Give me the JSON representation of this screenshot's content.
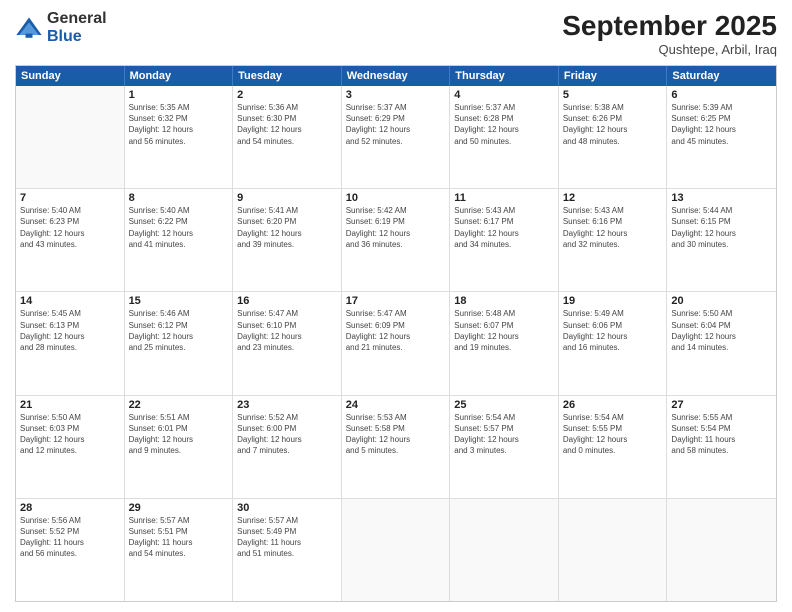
{
  "logo": {
    "general": "General",
    "blue": "Blue"
  },
  "title": "September 2025",
  "location": "Qushtepe, Arbil, Iraq",
  "days": [
    "Sunday",
    "Monday",
    "Tuesday",
    "Wednesday",
    "Thursday",
    "Friday",
    "Saturday"
  ],
  "weeks": [
    [
      {
        "day": "",
        "lines": []
      },
      {
        "day": "1",
        "lines": [
          "Sunrise: 5:35 AM",
          "Sunset: 6:32 PM",
          "Daylight: 12 hours",
          "and 56 minutes."
        ]
      },
      {
        "day": "2",
        "lines": [
          "Sunrise: 5:36 AM",
          "Sunset: 6:30 PM",
          "Daylight: 12 hours",
          "and 54 minutes."
        ]
      },
      {
        "day": "3",
        "lines": [
          "Sunrise: 5:37 AM",
          "Sunset: 6:29 PM",
          "Daylight: 12 hours",
          "and 52 minutes."
        ]
      },
      {
        "day": "4",
        "lines": [
          "Sunrise: 5:37 AM",
          "Sunset: 6:28 PM",
          "Daylight: 12 hours",
          "and 50 minutes."
        ]
      },
      {
        "day": "5",
        "lines": [
          "Sunrise: 5:38 AM",
          "Sunset: 6:26 PM",
          "Daylight: 12 hours",
          "and 48 minutes."
        ]
      },
      {
        "day": "6",
        "lines": [
          "Sunrise: 5:39 AM",
          "Sunset: 6:25 PM",
          "Daylight: 12 hours",
          "and 45 minutes."
        ]
      }
    ],
    [
      {
        "day": "7",
        "lines": [
          "Sunrise: 5:40 AM",
          "Sunset: 6:23 PM",
          "Daylight: 12 hours",
          "and 43 minutes."
        ]
      },
      {
        "day": "8",
        "lines": [
          "Sunrise: 5:40 AM",
          "Sunset: 6:22 PM",
          "Daylight: 12 hours",
          "and 41 minutes."
        ]
      },
      {
        "day": "9",
        "lines": [
          "Sunrise: 5:41 AM",
          "Sunset: 6:20 PM",
          "Daylight: 12 hours",
          "and 39 minutes."
        ]
      },
      {
        "day": "10",
        "lines": [
          "Sunrise: 5:42 AM",
          "Sunset: 6:19 PM",
          "Daylight: 12 hours",
          "and 36 minutes."
        ]
      },
      {
        "day": "11",
        "lines": [
          "Sunrise: 5:43 AM",
          "Sunset: 6:17 PM",
          "Daylight: 12 hours",
          "and 34 minutes."
        ]
      },
      {
        "day": "12",
        "lines": [
          "Sunrise: 5:43 AM",
          "Sunset: 6:16 PM",
          "Daylight: 12 hours",
          "and 32 minutes."
        ]
      },
      {
        "day": "13",
        "lines": [
          "Sunrise: 5:44 AM",
          "Sunset: 6:15 PM",
          "Daylight: 12 hours",
          "and 30 minutes."
        ]
      }
    ],
    [
      {
        "day": "14",
        "lines": [
          "Sunrise: 5:45 AM",
          "Sunset: 6:13 PM",
          "Daylight: 12 hours",
          "and 28 minutes."
        ]
      },
      {
        "day": "15",
        "lines": [
          "Sunrise: 5:46 AM",
          "Sunset: 6:12 PM",
          "Daylight: 12 hours",
          "and 25 minutes."
        ]
      },
      {
        "day": "16",
        "lines": [
          "Sunrise: 5:47 AM",
          "Sunset: 6:10 PM",
          "Daylight: 12 hours",
          "and 23 minutes."
        ]
      },
      {
        "day": "17",
        "lines": [
          "Sunrise: 5:47 AM",
          "Sunset: 6:09 PM",
          "Daylight: 12 hours",
          "and 21 minutes."
        ]
      },
      {
        "day": "18",
        "lines": [
          "Sunrise: 5:48 AM",
          "Sunset: 6:07 PM",
          "Daylight: 12 hours",
          "and 19 minutes."
        ]
      },
      {
        "day": "19",
        "lines": [
          "Sunrise: 5:49 AM",
          "Sunset: 6:06 PM",
          "Daylight: 12 hours",
          "and 16 minutes."
        ]
      },
      {
        "day": "20",
        "lines": [
          "Sunrise: 5:50 AM",
          "Sunset: 6:04 PM",
          "Daylight: 12 hours",
          "and 14 minutes."
        ]
      }
    ],
    [
      {
        "day": "21",
        "lines": [
          "Sunrise: 5:50 AM",
          "Sunset: 6:03 PM",
          "Daylight: 12 hours",
          "and 12 minutes."
        ]
      },
      {
        "day": "22",
        "lines": [
          "Sunrise: 5:51 AM",
          "Sunset: 6:01 PM",
          "Daylight: 12 hours",
          "and 9 minutes."
        ]
      },
      {
        "day": "23",
        "lines": [
          "Sunrise: 5:52 AM",
          "Sunset: 6:00 PM",
          "Daylight: 12 hours",
          "and 7 minutes."
        ]
      },
      {
        "day": "24",
        "lines": [
          "Sunrise: 5:53 AM",
          "Sunset: 5:58 PM",
          "Daylight: 12 hours",
          "and 5 minutes."
        ]
      },
      {
        "day": "25",
        "lines": [
          "Sunrise: 5:54 AM",
          "Sunset: 5:57 PM",
          "Daylight: 12 hours",
          "and 3 minutes."
        ]
      },
      {
        "day": "26",
        "lines": [
          "Sunrise: 5:54 AM",
          "Sunset: 5:55 PM",
          "Daylight: 12 hours",
          "and 0 minutes."
        ]
      },
      {
        "day": "27",
        "lines": [
          "Sunrise: 5:55 AM",
          "Sunset: 5:54 PM",
          "Daylight: 11 hours",
          "and 58 minutes."
        ]
      }
    ],
    [
      {
        "day": "28",
        "lines": [
          "Sunrise: 5:56 AM",
          "Sunset: 5:52 PM",
          "Daylight: 11 hours",
          "and 56 minutes."
        ]
      },
      {
        "day": "29",
        "lines": [
          "Sunrise: 5:57 AM",
          "Sunset: 5:51 PM",
          "Daylight: 11 hours",
          "and 54 minutes."
        ]
      },
      {
        "day": "30",
        "lines": [
          "Sunrise: 5:57 AM",
          "Sunset: 5:49 PM",
          "Daylight: 11 hours",
          "and 51 minutes."
        ]
      },
      {
        "day": "",
        "lines": []
      },
      {
        "day": "",
        "lines": []
      },
      {
        "day": "",
        "lines": []
      },
      {
        "day": "",
        "lines": []
      }
    ]
  ]
}
